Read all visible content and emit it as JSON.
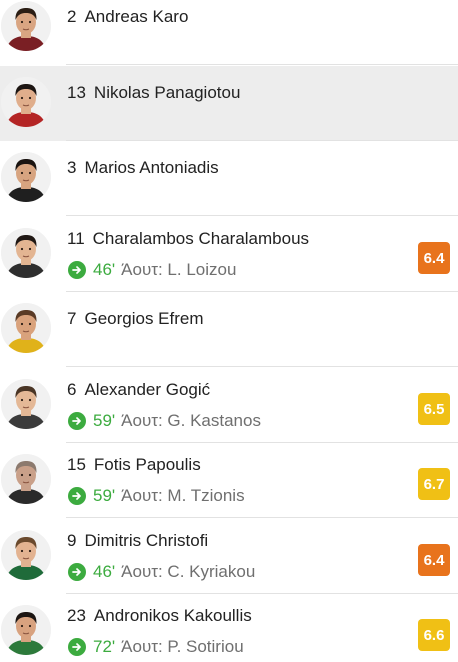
{
  "players": [
    {
      "number": "2",
      "name": "Andreas Karo",
      "skin": "#d9a582",
      "hair": "#2b1d14",
      "shirt": "#7a1f24"
    },
    {
      "number": "13",
      "name": "Nikolas Panagiotou",
      "skin": "#e0ae8c",
      "hair": "#1d1613",
      "shirt": "#b42525",
      "highlighted": true
    },
    {
      "number": "3",
      "name": "Marios Antoniadis",
      "skin": "#d7a480",
      "hair": "#1a1411",
      "shirt": "#1f1f1f"
    },
    {
      "number": "11",
      "name": "Charalambos Charalambous",
      "skin": "#e3b592",
      "hair": "#201814",
      "shirt": "#2e2e2e",
      "sub": {
        "minute": "46'",
        "text": "Άουτ: L. Loizou"
      },
      "rating": "6.4",
      "rating_color": "#e8731c"
    },
    {
      "number": "7",
      "name": "Georgios Efrem",
      "skin": "#d9a27c",
      "hair": "#5a3b26",
      "shirt": "#e0b21a"
    },
    {
      "number": "6",
      "name": "Alexander Gogić",
      "skin": "#e4b896",
      "hair": "#4a3525",
      "shirt": "#3b3b3b",
      "sub": {
        "minute": "59'",
        "text": "Άουτ: G. Kastanos"
      },
      "rating": "6.5",
      "rating_color": "#f0c015"
    },
    {
      "number": "15",
      "name": "Fotis Papoulis",
      "skin": "#c9a089",
      "hair": "#8c7a6e",
      "shirt": "#2a2a2a",
      "sub": {
        "minute": "59'",
        "text": "Άουτ: M. Tzionis"
      },
      "rating": "6.7",
      "rating_color": "#f0c015"
    },
    {
      "number": "9",
      "name": "Dimitris Christofi",
      "skin": "#e3b391",
      "hair": "#6b4a2e",
      "shirt": "#1f6b3a",
      "sub": {
        "minute": "46'",
        "text": "Άουτ: C. Kyriakou"
      },
      "rating": "6.4",
      "rating_color": "#e8731c"
    },
    {
      "number": "23",
      "name": "Andronikos Kakoullis",
      "skin": "#d8a27f",
      "hair": "#1c1512",
      "shirt": "#2d7a3b",
      "sub": {
        "minute": "72'",
        "text": "Άουτ: P. Sotiriou"
      },
      "rating": "6.6",
      "rating_color": "#f0c015"
    }
  ]
}
